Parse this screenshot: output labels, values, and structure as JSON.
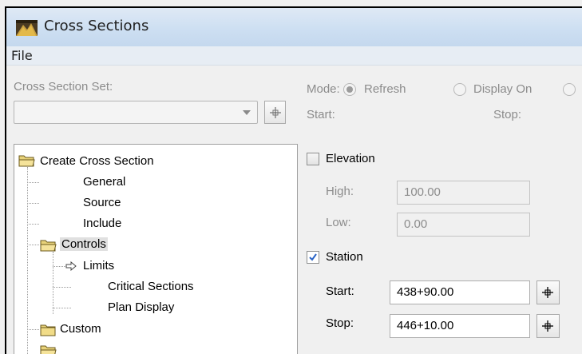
{
  "window": {
    "title": "Cross Sections"
  },
  "menu": {
    "file": "File"
  },
  "cross_section_set": {
    "label": "Cross Section Set:",
    "value": ""
  },
  "mode": {
    "label": "Mode:",
    "refresh": "Refresh",
    "display_on": "Display On",
    "selected": "Refresh"
  },
  "range_labels": {
    "start": "Start:",
    "stop": "Stop:"
  },
  "tree": {
    "root": "Create Cross Section",
    "items": [
      "General",
      "Source",
      "Include"
    ],
    "controls": "Controls",
    "controls_children": [
      "Limits",
      "Critical Sections",
      "Plan Display"
    ],
    "custom": "Custom",
    "selected": "Controls"
  },
  "elevation": {
    "label": "Elevation",
    "checked": false,
    "high_label": "High:",
    "high_value": "100.00",
    "low_label": "Low:",
    "low_value": "0.00"
  },
  "station": {
    "label": "Station",
    "checked": true,
    "start_label": "Start:",
    "start_value": "438+90.00",
    "stop_label": "Stop:",
    "stop_value": "446+10.00"
  },
  "icons": {
    "app": "cross-sections-app-icon",
    "pick": "crosshair-pick-icon",
    "folder": "folder-open-icon",
    "arrow": "current-item-arrow-icon"
  }
}
